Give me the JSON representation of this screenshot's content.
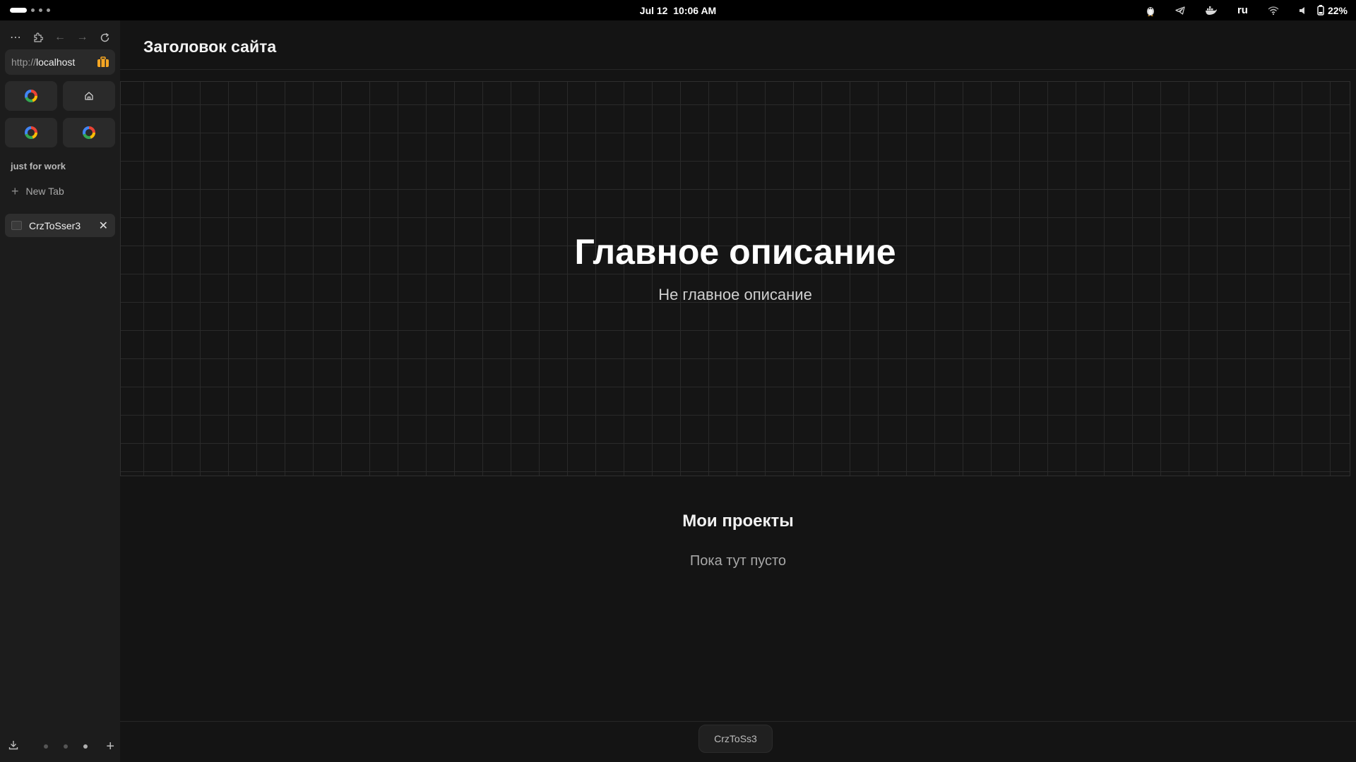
{
  "system_bar": {
    "date": "Jul 12",
    "time": "10:06 AM",
    "language": "ru",
    "battery": "22%",
    "tray_icons": [
      "linux-tux-icon",
      "telegram-icon",
      "docker-icon",
      "wifi-icon",
      "volume-icon",
      "battery-icon"
    ]
  },
  "browser": {
    "url_protocol": "http://",
    "url_host": "localhost",
    "nav_icons": [
      "menu-icon",
      "extensions-icon",
      "back-icon",
      "forward-icon",
      "reload-icon"
    ],
    "pinned": [
      "google",
      "home",
      "google",
      "google"
    ],
    "workspace_name": "just for work",
    "new_tab_label": "New Tab",
    "tabs": [
      {
        "title": "CrzToSser3"
      }
    ]
  },
  "site": {
    "header_title": "Заголовок сайта",
    "hero_title": "Главное описание",
    "hero_subtitle": "Не главное описание",
    "projects_title": "Мои проекты",
    "projects_empty": "Пока тут пусто",
    "footer_text": "CrzToSs3"
  },
  "colors": {
    "background": "#141414",
    "sidebar": "#1c1c1c",
    "grid_line": "#2a2a2a",
    "extension_accent": "#f5a623"
  }
}
